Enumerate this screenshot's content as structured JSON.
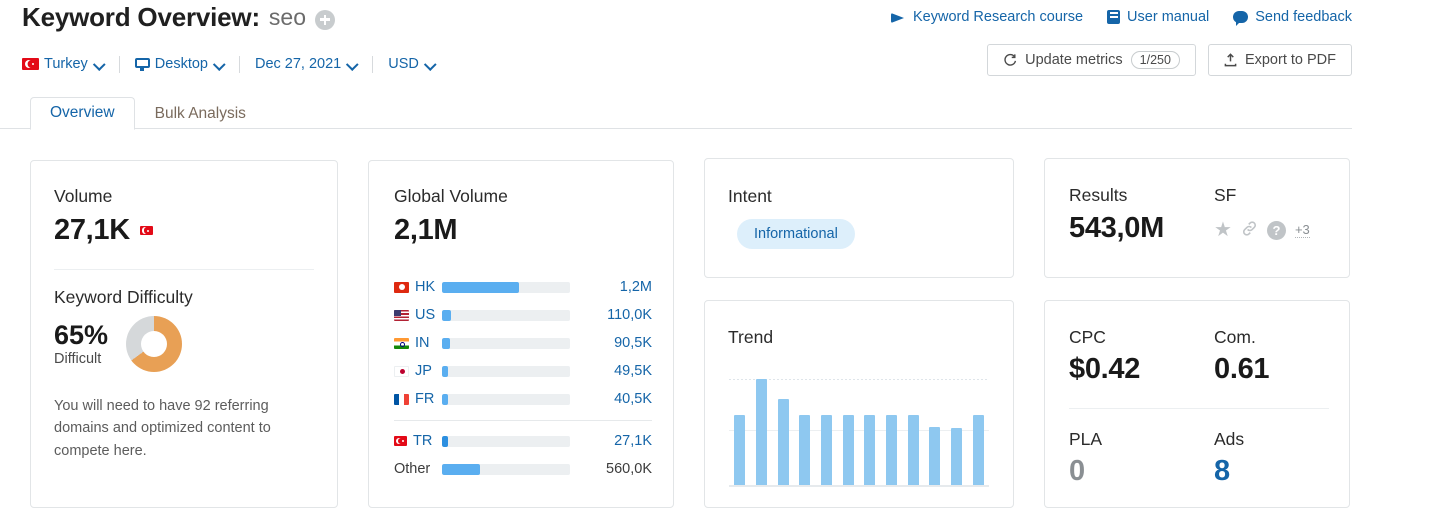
{
  "header": {
    "title_prefix": "Keyword Overview:",
    "keyword": "seo",
    "add_icon": "plus-circle-icon",
    "filters": [
      {
        "label": "Turkey",
        "icon": "turkey-flag-icon"
      },
      {
        "label": "Desktop",
        "icon": "monitor-icon"
      },
      {
        "label": "Dec 27, 2021",
        "icon": ""
      },
      {
        "label": "USD",
        "icon": ""
      }
    ],
    "links": [
      {
        "label": "Keyword Research course",
        "icon": "graduation-cap-icon"
      },
      {
        "label": "User manual",
        "icon": "book-icon"
      },
      {
        "label": "Send feedback",
        "icon": "speech-bubble-icon"
      }
    ],
    "buttons": {
      "update_metrics": "Update metrics",
      "update_metrics_count": "1/250",
      "export_pdf": "Export to PDF"
    }
  },
  "tabs": [
    {
      "label": "Overview",
      "active": true
    },
    {
      "label": "Bulk Analysis",
      "active": false
    }
  ],
  "volume_card": {
    "title": "Volume",
    "value": "27,1K",
    "flag": "turkey-flag-icon",
    "kd_title": "Keyword Difficulty",
    "kd_percent": "65%",
    "kd_level": "Difficult",
    "kd_value": 65,
    "kd_color": "#e8a055",
    "kd_track_color": "#d5d8da",
    "description": "You will need to have 92 referring domains and optimized content to compete here."
  },
  "global_card": {
    "title": "Global Volume",
    "value": "2,1M",
    "rows": [
      {
        "code": "HK",
        "flag": "hongkong-flag-icon",
        "value": "1,2M",
        "pct": 60
      },
      {
        "code": "US",
        "flag": "usa-flag-icon",
        "value": "110,0K",
        "pct": 7
      },
      {
        "code": "IN",
        "flag": "india-flag-icon",
        "value": "90,5K",
        "pct": 6
      },
      {
        "code": "JP",
        "flag": "japan-flag-icon",
        "value": "49,5K",
        "pct": 5
      },
      {
        "code": "FR",
        "flag": "france-flag-icon",
        "value": "40,5K",
        "pct": 5
      }
    ],
    "rows_secondary": [
      {
        "code": "TR",
        "flag": "turkey-flag-icon",
        "value": "27,1K",
        "pct": 5,
        "dark": true
      },
      {
        "code": "Other",
        "flag": "",
        "value": "560,0K",
        "pct": 30,
        "dark": false
      }
    ]
  },
  "intent_card": {
    "title": "Intent",
    "badge": "Informational"
  },
  "trend_card": {
    "title": "Trend"
  },
  "results_card": {
    "results_label": "Results",
    "results_value": "543,0M",
    "sf_label": "SF",
    "sf_icons": [
      "star-icon",
      "link-icon",
      "question-mark-icon"
    ],
    "sf_more": "+3"
  },
  "cpc_card": {
    "cpc_label": "CPC",
    "cpc_value": "$0.42",
    "com_label": "Com.",
    "com_value": "0.61",
    "pla_label": "PLA",
    "pla_value": "0",
    "ads_label": "Ads",
    "ads_value": "8"
  },
  "chart_data": {
    "type": "bar",
    "title": "Trend",
    "categories": [
      "1",
      "2",
      "3",
      "4",
      "5",
      "6",
      "7",
      "8",
      "9",
      "10",
      "11",
      "12"
    ],
    "values": [
      66,
      100,
      81,
      66,
      66,
      66,
      66,
      66,
      66,
      55,
      54,
      66
    ],
    "ylim": [
      0,
      100
    ],
    "xlabel": "",
    "ylabel": "",
    "grid": true,
    "legend": false,
    "bar_color": "#8ec8f0"
  }
}
